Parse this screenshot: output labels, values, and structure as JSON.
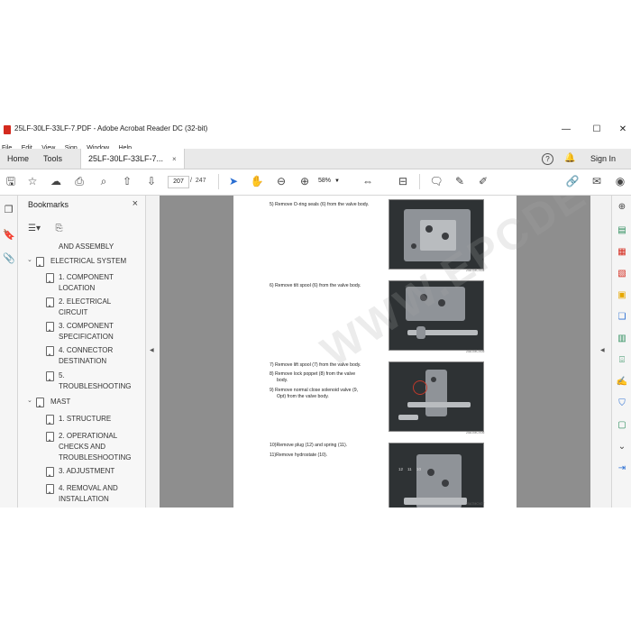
{
  "window": {
    "title": "25LF-30LF-33LF-7.PDF - Adobe Acrobat Reader DC (32-bit)",
    "minimize": "—",
    "maximize": "☐",
    "close": "✕"
  },
  "menu": [
    "File",
    "Edit",
    "View",
    "Sign",
    "Window",
    "Help"
  ],
  "tabs": {
    "home": "Home",
    "tools": "Tools",
    "document": "25LF-30LF-33LF-7...",
    "document_close": "×",
    "help_icon": "?",
    "signin": "Sign In"
  },
  "toolbar": {
    "page_current": "207",
    "page_separator": "/",
    "page_total": "247",
    "zoom": "58%"
  },
  "bookmarks": {
    "title": "Bookmarks",
    "close": "×",
    "items": [
      {
        "text": "AND ASSEMBLY"
      },
      {
        "text": "ELECTRICAL SYSTEM"
      },
      {
        "text": "1. COMPONENT"
      },
      {
        "text": "LOCATION"
      },
      {
        "text": "2. ELECTRICAL"
      },
      {
        "text": "CIRCUIT"
      },
      {
        "text": "3. COMPONENT"
      },
      {
        "text": "SPECIFICATION"
      },
      {
        "text": "4. CONNECTOR"
      },
      {
        "text": "DESTINATION"
      },
      {
        "text": "5."
      },
      {
        "text": "TROUBLESHOOTING"
      },
      {
        "text": "MAST"
      },
      {
        "text": "1. STRUCTURE"
      },
      {
        "text": "2. OPERATIONAL"
      },
      {
        "text": "CHECKS AND"
      },
      {
        "text": "TROUBLESHOOTING"
      },
      {
        "text": "3. ADJUSTMENT"
      },
      {
        "text": "4. REMOVAL AND"
      },
      {
        "text": "INSTALLATION"
      }
    ]
  },
  "document": {
    "steps": [
      "5)  Remove O-ring seals (6) from the valve body.",
      "6)  Remove tilt spool (6) from the valve body.",
      "7)  Remove lift spool (7) from the valve body.",
      "8)  Remove lock poppet (8) from the valve",
      "body.",
      "9)  Remove normal close solenoid valve (9,",
      "Opt) from the valve body.",
      "10)Remove plug (12) and spring (11).",
      "11)Remove hydrostate (10)."
    ],
    "captions": [
      "25A7MCV04",
      "25A7MCV05",
      "25A7MCV06",
      "25A7MCV07"
    ],
    "photo_labels": [
      "12",
      "11",
      "10"
    ],
    "watermark": "WWW.EPCDEPOT.COM"
  },
  "colors": {
    "accent": "#2a6ed2",
    "pdf_red": "#d42a1e",
    "doc_background": "#8e8e8e"
  }
}
